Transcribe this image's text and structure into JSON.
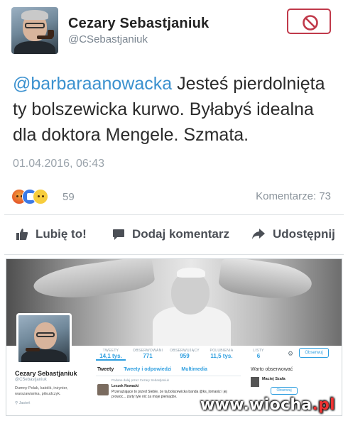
{
  "tweet": {
    "author_name": "Cezary Sebastjaniuk",
    "author_handle": "@CSebastjaniuk",
    "mention": "@barbaraanowacka",
    "text": " Jesteś pierdolnięta ty bolszewicka kurwo. Byłabyś idealna dla doktora Mengele. Szmata.",
    "timestamp": "01.04.2016, 06:43"
  },
  "reactions": {
    "icons": [
      "angry-icon",
      "like-icon",
      "sad-icon"
    ],
    "count": "59",
    "comments": "Komentarze: 73"
  },
  "actions": {
    "like": "Lubię to!",
    "comment": "Dodaj komentarz",
    "share": "Udostępnij"
  },
  "embedded_profile": {
    "stats": [
      {
        "label": "TWEETY",
        "value": "14,1 tys."
      },
      {
        "label": "OBSERWOWANI",
        "value": "771"
      },
      {
        "label": "OBSERWUJĄCY",
        "value": "959"
      },
      {
        "label": "POLUBIENIA",
        "value": "11,5 tys."
      },
      {
        "label": "LISTY",
        "value": "6"
      }
    ],
    "follow_label": "Obserwuj",
    "name": "Cezary Sebastjaniuk",
    "handle": "@CSebastjaniuk",
    "bio": "Dumny Polak, katolik, inżynier, warszawianka, piłsudczyk.",
    "location": "Jasień",
    "tabs": [
      "Tweety",
      "Tweety i odpowiedzi",
      "Multimedia"
    ],
    "retweet_note": "Podane dalej przez Cezary Sebastjaniuk",
    "tweet_author": "Leszek Nowacki",
    "tweet_body": "Przeraziające to przed Siebie, że tą bolszewicka banda @ks_lomaniz i jej prowoc... żarty tyle nić za moje pieniądze.",
    "who_to_follow": "Warto obserwować",
    "who_name": "Maciej Szafa",
    "who_follow": "Obserwuj"
  },
  "watermark": {
    "prefix": "www.",
    "brand": "wiocha",
    "suffix": ".pl"
  },
  "colors": {
    "mention": "#3b91cf",
    "block_border": "#c0394a",
    "twitter_blue": "#2f9fe0"
  }
}
